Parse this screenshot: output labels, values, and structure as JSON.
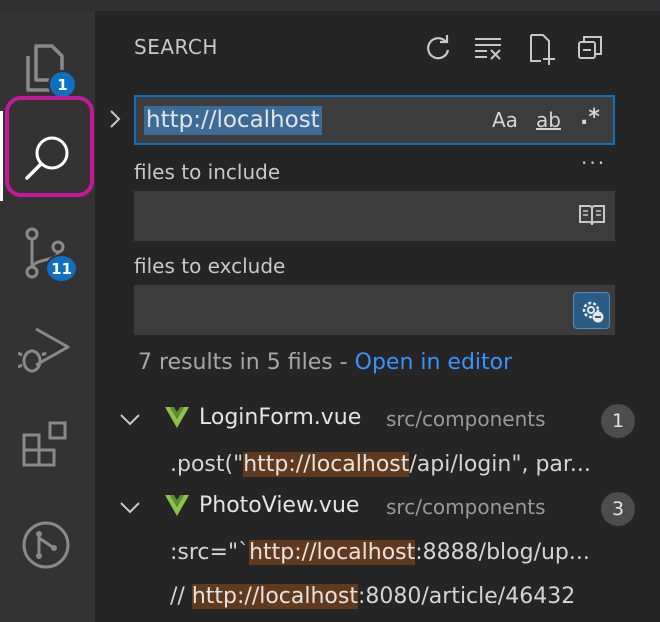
{
  "activity_bar": {
    "items": [
      {
        "name": "explorer",
        "badge": "1"
      },
      {
        "name": "search",
        "badge": ""
      },
      {
        "name": "source-control",
        "badge": "11"
      },
      {
        "name": "run-debug",
        "badge": ""
      },
      {
        "name": "extensions",
        "badge": ""
      },
      {
        "name": "remote",
        "badge": ""
      }
    ]
  },
  "sidebar": {
    "title": "SEARCH",
    "actions": [
      "refresh-icon",
      "clear-results-icon",
      "new-search-editor-icon",
      "collapse-all-icon"
    ]
  },
  "search": {
    "query": "http://localhost",
    "options": {
      "match_case": "Aa",
      "whole_word": "ab",
      "regex": ".*"
    },
    "more": "···"
  },
  "include": {
    "label": "files to include",
    "value": ""
  },
  "exclude": {
    "label": "files to exclude",
    "value": ""
  },
  "results": {
    "summary": "7 results in 5 files - ",
    "open_in_editor": "Open in editor",
    "files": [
      {
        "name": "LoginForm.vue",
        "path": "src/components",
        "count": "1",
        "matches": [
          {
            "before": ".post(\"",
            "match": "http://localhost",
            "after": "/api/login\", par..."
          }
        ]
      },
      {
        "name": "PhotoView.vue",
        "path": "src/components",
        "count": "3",
        "matches": [
          {
            "before": ":src=\"`",
            "match": "http://localhost",
            "after": ":8888/blog/up..."
          },
          {
            "before": "// ",
            "match": "http://localhost",
            "after": ":8080/article/46432"
          }
        ]
      }
    ]
  },
  "colors": {
    "accent": "#0e70c0",
    "highlight_border": "#c5179c",
    "match_bg": "#613a1e",
    "vue_green": "#8dc149"
  }
}
